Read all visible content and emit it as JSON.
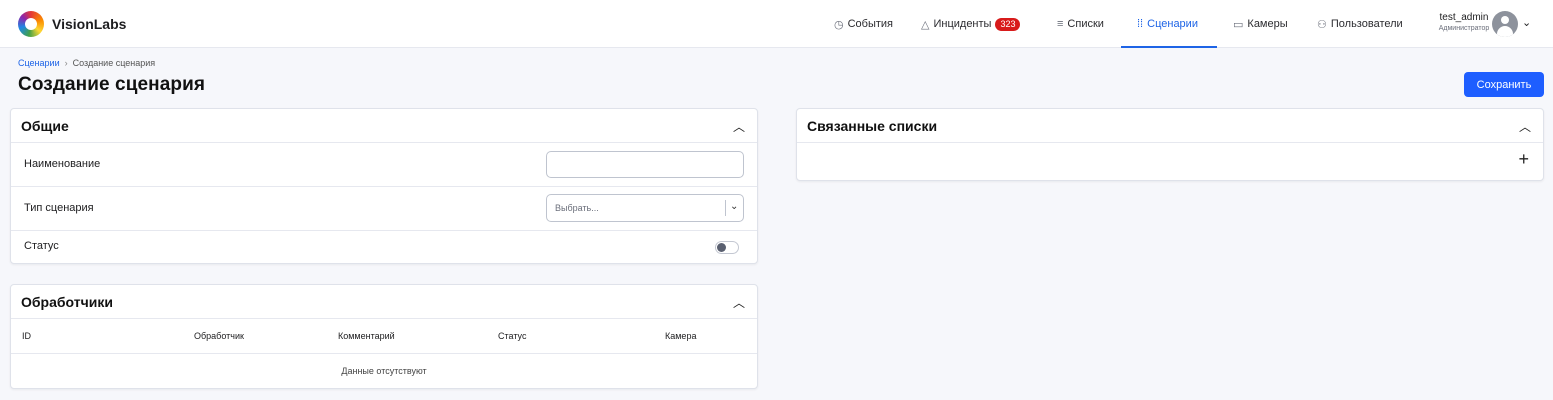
{
  "app": {
    "name": "VisionLabs"
  },
  "nav": {
    "items": [
      {
        "label": "События",
        "icon": "clock-icon"
      },
      {
        "label": "Инциденты",
        "icon": "warning-icon",
        "badge": "323"
      },
      {
        "label": "Списки",
        "icon": "list-icon"
      },
      {
        "label": "Сценарии",
        "icon": "scenario-icon",
        "active": true
      },
      {
        "label": "Камеры",
        "icon": "camera-icon"
      },
      {
        "label": "Пользователи",
        "icon": "users-icon"
      }
    ]
  },
  "user": {
    "name": "test_admin",
    "role": "Администратор"
  },
  "breadcrumb": {
    "parent": "Сценарии",
    "separator": "›",
    "current": "Создание сценария"
  },
  "page": {
    "title": "Создание сценария",
    "save_label": "Сохранить"
  },
  "general": {
    "title": "Общие",
    "name_label": "Наименование",
    "name_value": "",
    "type_label": "Тип сценария",
    "type_placeholder": "Выбрать...",
    "status_label": "Статус",
    "status_on": false
  },
  "handlers": {
    "title": "Обработчики",
    "columns": [
      "ID",
      "Обработчик",
      "Комментарий",
      "Статус",
      "Камера"
    ],
    "empty_text": "Данные отсутствуют"
  },
  "linked_lists": {
    "title": "Связанные списки"
  },
  "colors": {
    "accent": "#1e64e6",
    "badge": "#d81b1b",
    "save": "#1e5eff"
  }
}
